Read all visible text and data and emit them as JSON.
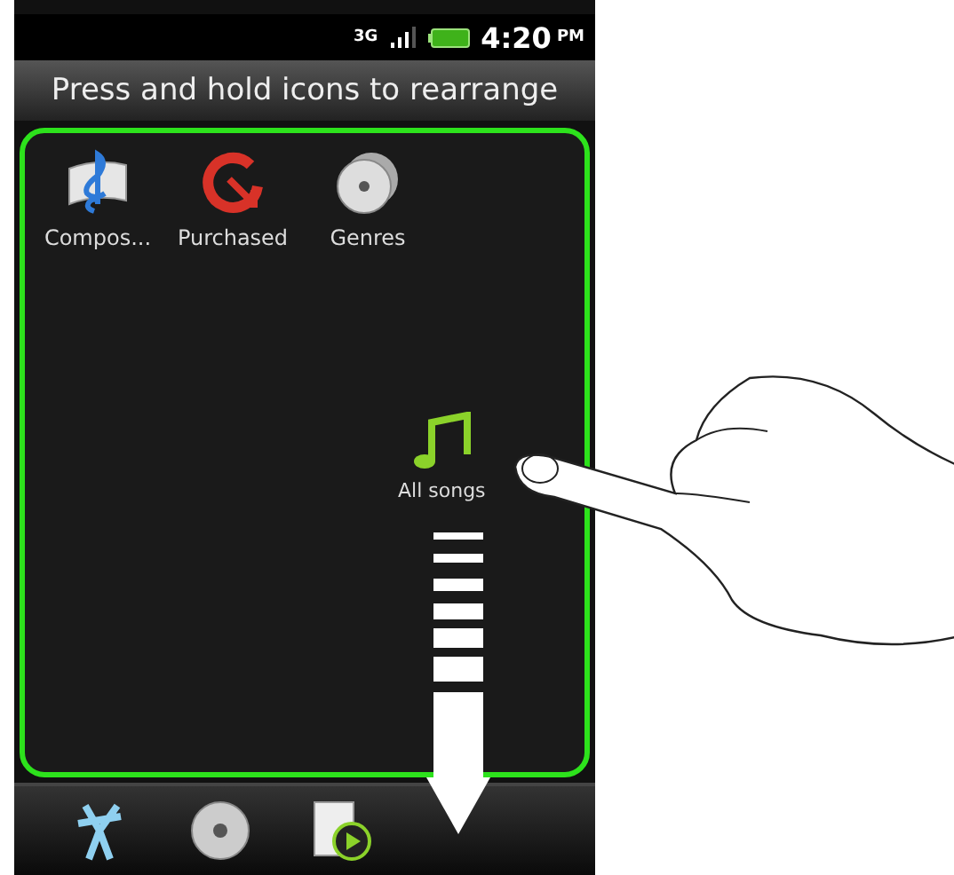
{
  "status_bar": {
    "network": "3G",
    "time": "4:20",
    "ampm": "PM"
  },
  "header": {
    "title": "Press and hold icons to rearrange"
  },
  "grid": {
    "items": [
      {
        "label": "Compos...",
        "kind": "clef"
      },
      {
        "label": "Purchased",
        "kind": "purchased"
      },
      {
        "label": "Genres",
        "kind": "disc"
      }
    ]
  },
  "dragged_item": {
    "label": "All songs"
  },
  "dock": {
    "items": [
      {
        "kind": "artist"
      },
      {
        "kind": "disc"
      },
      {
        "kind": "playlist"
      }
    ]
  }
}
